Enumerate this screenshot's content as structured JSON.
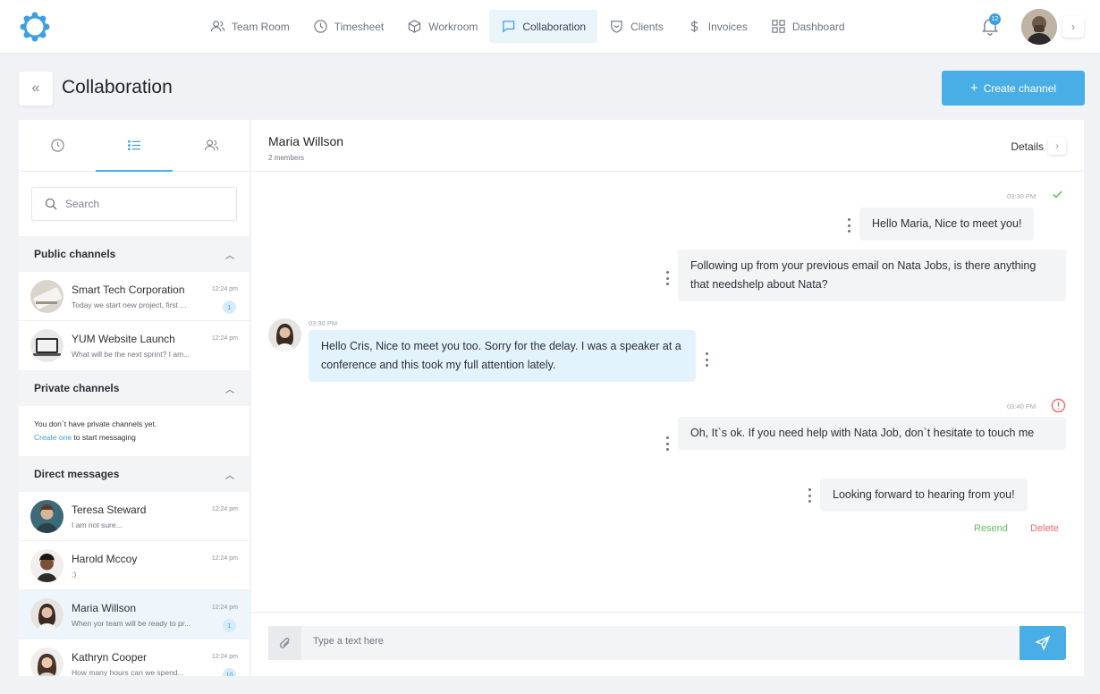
{
  "nav": {
    "items": [
      {
        "label": "Team Room",
        "icon": "users-icon"
      },
      {
        "label": "Timesheet",
        "icon": "clock-icon"
      },
      {
        "label": "Workroom",
        "icon": "cube-icon"
      },
      {
        "label": "Collaboration",
        "icon": "chat-icon"
      },
      {
        "label": "Clients",
        "icon": "shield-icon"
      },
      {
        "label": "Invoices",
        "icon": "dollar-icon"
      },
      {
        "label": "Dashboard",
        "icon": "grid-icon"
      }
    ],
    "active": "Collaboration",
    "notification_count": "12"
  },
  "page": {
    "title": "Collaboration",
    "create_button": "Create channel"
  },
  "sidebar": {
    "search_placeholder": "Search",
    "public_title": "Public channels",
    "public_channels": [
      {
        "name": "Smart Tech Corporation",
        "preview": "Today we start new project, first ...",
        "time": "12:24 pm",
        "badge": "1"
      },
      {
        "name": "YUM Website Launch",
        "preview": "What will be the next sprint? I am...",
        "time": "12:24 pm",
        "badge": ""
      }
    ],
    "private_title": "Private channels",
    "private_empty": "You don`t have private channels yet.",
    "private_link": "Create one",
    "private_suffix": " to start messaging",
    "direct_title": "Direct messages",
    "direct_messages": [
      {
        "name": "Teresa Steward",
        "preview": "I am not sure...",
        "time": "12:24 pm",
        "badge": ""
      },
      {
        "name": "Harold Mccoy",
        "preview": ":)",
        "time": "12:24 pm",
        "badge": ""
      },
      {
        "name": "Maria Willson",
        "preview": "When yor team will be ready to pr...",
        "time": "12:24 pm",
        "badge": "1"
      },
      {
        "name": "Kathryn Cooper",
        "preview": "How many hours can we spend...",
        "time": "12:24 pm",
        "badge": "10"
      }
    ]
  },
  "chat": {
    "name": "Maria Willson",
    "members": "2 members",
    "details": "Details",
    "messages": [
      {
        "time": "03:30 PM",
        "text": "Hello Maria, Nice to meet you!"
      },
      {
        "text": "Following up from your previous email on Nata Jobs, is there anything that needshelp about Nata?"
      },
      {
        "time": "03:30 PM",
        "text": "Hello Cris, Nice to meet you too. Sorry for the delay. I was a speaker at a conference and this took my full attention lately."
      },
      {
        "time": "03:40 PM",
        "text": "Oh, It`s ok. If you need help with Nata Job, don`t hesitate to touch me"
      },
      {
        "text": "Looking forward to hearing from you!"
      }
    ],
    "resend": "Resend",
    "delete": "Delete",
    "composer_placeholder": "Type a text here"
  },
  "colors": {
    "accent": "#4aaee6",
    "success": "#5fbf5f",
    "error": "#ef6a6a"
  }
}
